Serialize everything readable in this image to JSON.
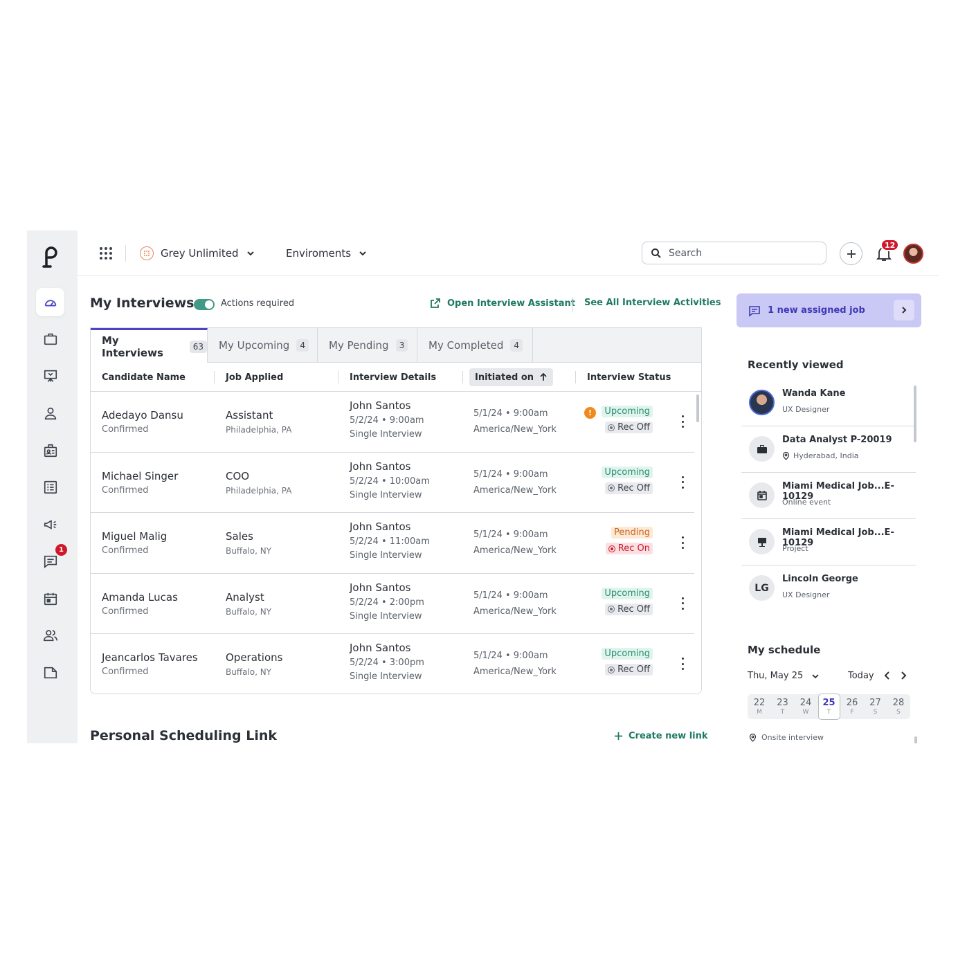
{
  "topbar": {
    "org_name": "Grey Unlimited",
    "env_label": "Enviroments",
    "search_placeholder": "Search",
    "notification_count": "12"
  },
  "sidebar": {
    "items": [
      {
        "icon": "dashboard-icon",
        "active": true
      },
      {
        "icon": "briefcase-icon"
      },
      {
        "icon": "presentation-icon"
      },
      {
        "icon": "person-icon"
      },
      {
        "icon": "id-badge-icon"
      },
      {
        "icon": "list-icon"
      },
      {
        "icon": "megaphone-icon"
      },
      {
        "icon": "chat-icon",
        "badge": "1"
      },
      {
        "icon": "calendar-icon"
      },
      {
        "icon": "users-icon"
      },
      {
        "icon": "folder-icon"
      }
    ]
  },
  "main": {
    "title": "My Interviews",
    "toggle_label": "Actions required",
    "open_assistant": "Open Interview Assistant",
    "see_all": "See All Interview Activities",
    "tabs": [
      {
        "label": "My Interviews",
        "count": "63"
      },
      {
        "label": "My Upcoming",
        "count": "4"
      },
      {
        "label": "My Pending",
        "count": "3"
      },
      {
        "label": "My Completed",
        "count": "4"
      }
    ],
    "columns": [
      "Candidate Name",
      "Job Applied",
      "Interview Details",
      "Initiated on",
      "Interview Status"
    ],
    "rows": [
      {
        "name": "Adedayo Dansu",
        "name_status": "Confirmed",
        "job": "Assistant",
        "location": "Philadelphia, PA",
        "interviewer": "John Santos",
        "datetime": "5/2/24 • 9:00am",
        "type": "Single Interview",
        "initiated": "5/1/24 • 9:00am",
        "timezone": "America/New_York",
        "status": "Upcoming",
        "rec": "Rec Off",
        "warn": "!"
      },
      {
        "name": "Michael Singer",
        "name_status": "Confirmed",
        "job": "COO",
        "location": "Philadelphia, PA",
        "interviewer": "John Santos",
        "datetime": "5/2/24 • 10:00am",
        "type": "Single Interview",
        "initiated": "5/1/24 • 9:00am",
        "timezone": "America/New_York",
        "status": "Upcoming",
        "rec": "Rec Off"
      },
      {
        "name": "Miguel Malig",
        "name_status": "Confirmed",
        "job": "Sales",
        "location": "Buffalo, NY",
        "interviewer": "John Santos",
        "datetime": "5/2/24 • 11:00am",
        "type": "Single Interview",
        "initiated": "5/1/24 • 9:00am",
        "timezone": "America/New_York",
        "status": "Pending",
        "rec": "Rec On"
      },
      {
        "name": "Amanda Lucas",
        "name_status": "Confirmed",
        "job": "Analyst",
        "location": "Buffalo, NY",
        "interviewer": "John Santos",
        "datetime": "5/2/24 • 2:00pm",
        "type": "Single Interview",
        "initiated": "5/1/24 • 9:00am",
        "timezone": "America/New_York",
        "status": "Upcoming",
        "rec": "Rec Off"
      },
      {
        "name": "Jeancarlos Tavares",
        "name_status": "Confirmed",
        "job": "Operations",
        "location": "Buffalo, NY",
        "interviewer": "John Santos",
        "datetime": "5/2/24 • 3:00pm",
        "type": "Single Interview",
        "initiated": "5/1/24 • 9:00am",
        "timezone": "America/New_York",
        "status": "Upcoming",
        "rec": "Rec Off"
      }
    ],
    "psl_title": "Personal Scheduling Link",
    "create_link": "Create new link"
  },
  "right": {
    "assigned_job": "1 new assigned job",
    "recently_viewed_title": "Recently viewed",
    "recently_viewed": [
      {
        "name": "Wanda Kane",
        "sub": "UX Designer",
        "icon": "avatar"
      },
      {
        "name": "Data Analyst P-20019",
        "sub": "Hyderabad, India",
        "icon": "briefcase-icon"
      },
      {
        "name": "Miami Medical Job...E-10129",
        "sub": "Online event",
        "icon": "calendar-icon"
      },
      {
        "name": "Miami Medical Job...E-10129",
        "sub": "Project",
        "icon": "presentation-icon"
      },
      {
        "name": "Lincoln George",
        "sub": "UX Designer",
        "initials": "LG"
      }
    ],
    "schedule_title": "My schedule",
    "schedule_date": "Thu, May 25",
    "today_label": "Today",
    "week": [
      {
        "n": "22",
        "w": "M"
      },
      {
        "n": "23",
        "w": "T"
      },
      {
        "n": "24",
        "w": "W"
      },
      {
        "n": "25",
        "w": "T",
        "selected": true
      },
      {
        "n": "26",
        "w": "F"
      },
      {
        "n": "27",
        "w": "S"
      },
      {
        "n": "28",
        "w": "S"
      }
    ],
    "onsite_label": "Onsite interview"
  },
  "colors": {
    "accent": "#4b45c6",
    "green_link": "#1f7a63",
    "badge_red": "#d1182b",
    "assigned_bg": "#cac8f4"
  }
}
